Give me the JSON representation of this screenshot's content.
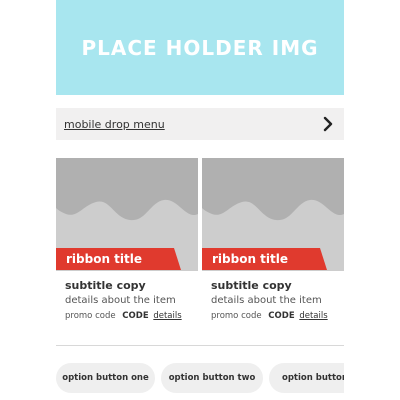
{
  "hero": {
    "text": "PLACE HOLDER IMG"
  },
  "dropmenu": {
    "label": "mobile drop menu"
  },
  "cards": [
    {
      "ribbon": "ribbon title",
      "subtitle": "subtitle copy",
      "details": "details about the item",
      "promo_label": "promo code",
      "promo_code": "CODE",
      "promo_link": "details"
    },
    {
      "ribbon": "ribbon title",
      "subtitle": "subtitle copy",
      "details": "details about the item",
      "promo_label": "promo code",
      "promo_code": "CODE",
      "promo_link": "details"
    }
  ],
  "options": [
    {
      "label": "option button one"
    },
    {
      "label": "option button two"
    },
    {
      "label": "option button three"
    }
  ],
  "colors": {
    "hero_bg": "#a8e6ef",
    "ribbon": "#e03a2e",
    "menu_bg": "#f1f0f0",
    "option_bg": "#efefef"
  }
}
